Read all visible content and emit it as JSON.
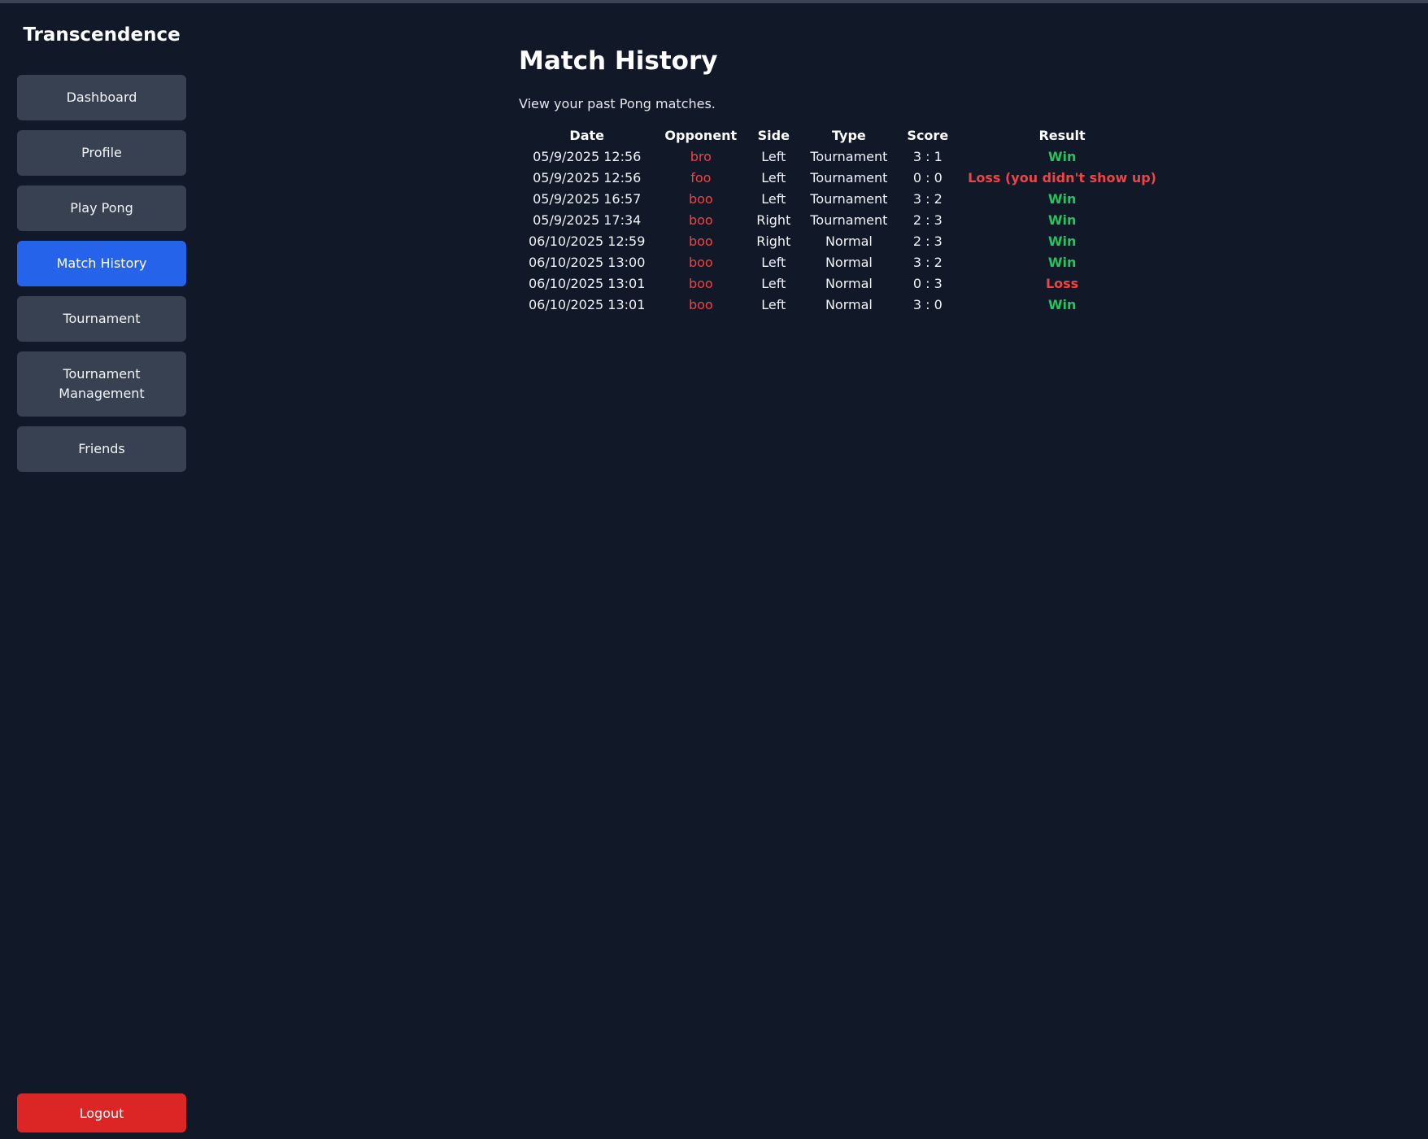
{
  "sidebar": {
    "brand": "Transcendence",
    "items": [
      {
        "label": "Dashboard"
      },
      {
        "label": "Profile"
      },
      {
        "label": "Play Pong"
      },
      {
        "label": "Match History"
      },
      {
        "label": "Tournament"
      },
      {
        "label": "Tournament Management"
      },
      {
        "label": "Friends"
      }
    ],
    "active_item": "Match History",
    "logout_label": "Logout"
  },
  "main": {
    "title": "Match History",
    "subtitle": "View your past Pong matches.",
    "table": {
      "headers": [
        "Date",
        "Opponent",
        "Side",
        "Type",
        "Score",
        "Result"
      ],
      "rows": [
        {
          "date": "05/9/2025 12:56",
          "opponent": "bro",
          "side": "Left",
          "type": "Tournament",
          "score": "3 : 1",
          "result": "Win"
        },
        {
          "date": "05/9/2025 12:56",
          "opponent": "foo",
          "side": "Left",
          "type": "Tournament",
          "score": "0 : 0",
          "result": "Loss (you didn't show up)"
        },
        {
          "date": "05/9/2025 16:57",
          "opponent": "boo",
          "side": "Left",
          "type": "Tournament",
          "score": "3 : 2",
          "result": "Win"
        },
        {
          "date": "05/9/2025 17:34",
          "opponent": "boo",
          "side": "Right",
          "type": "Tournament",
          "score": "2 : 3",
          "result": "Win"
        },
        {
          "date": "06/10/2025 12:59",
          "opponent": "boo",
          "side": "Right",
          "type": "Normal",
          "score": "2 : 3",
          "result": "Win"
        },
        {
          "date": "06/10/2025 13:00",
          "opponent": "boo",
          "side": "Left",
          "type": "Normal",
          "score": "3 : 2",
          "result": "Win"
        },
        {
          "date": "06/10/2025 13:01",
          "opponent": "boo",
          "side": "Left",
          "type": "Normal",
          "score": "0 : 3",
          "result": "Loss"
        },
        {
          "date": "06/10/2025 13:01",
          "opponent": "boo",
          "side": "Left",
          "type": "Normal",
          "score": "3 : 0",
          "result": "Win"
        }
      ]
    }
  },
  "colors": {
    "background": "#111827",
    "nav_button": "#374151",
    "nav_active": "#2563eb",
    "logout": "#dc2626",
    "win": "#22c55e",
    "loss": "#ef4444",
    "opponent": "#ef4444"
  }
}
